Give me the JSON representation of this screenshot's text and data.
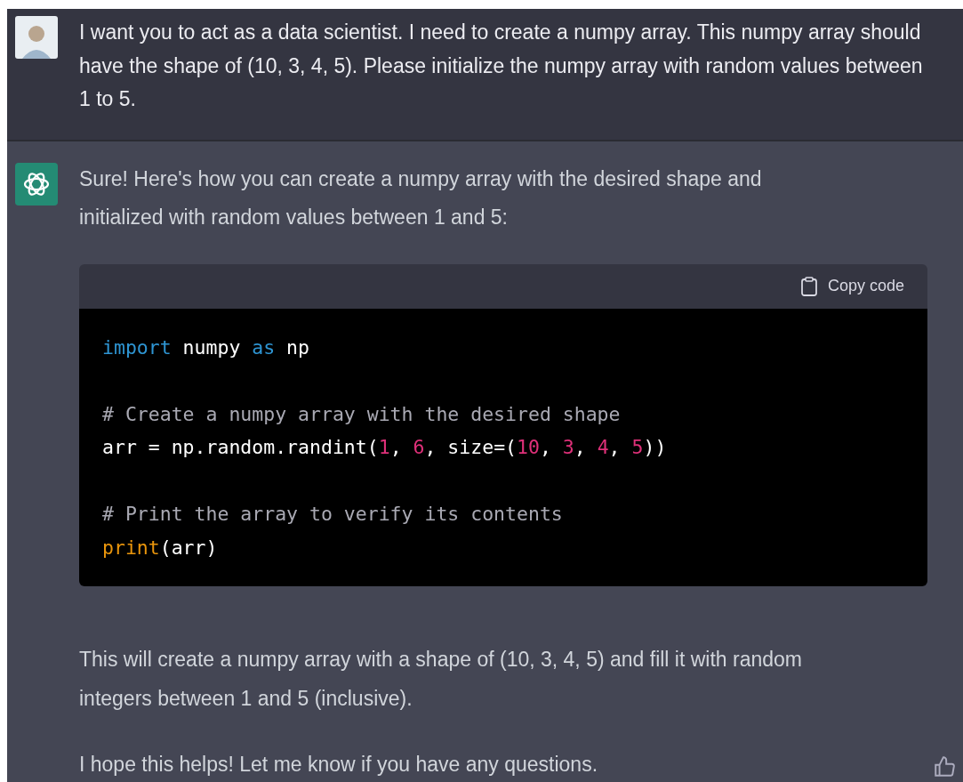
{
  "user_message": {
    "text": "I want you to act as a data scientist. I need to create a numpy array. This numpy array should have the shape of (10, 3, 4, 5). Please initialize the numpy array with random values between 1 to 5."
  },
  "assistant_message": {
    "intro": "Sure! Here's how you can create a numpy array with the desired shape and initialized with random values between 1 and 5:",
    "code_block": {
      "copy_label": "Copy code",
      "groups": [
        [
          [
            {
              "kind": "keyword",
              "text": "import"
            },
            {
              "kind": "plain",
              "text": " numpy "
            },
            {
              "kind": "keyword",
              "text": "as"
            },
            {
              "kind": "plain",
              "text": " np"
            }
          ]
        ],
        [
          [
            {
              "kind": "comment",
              "text": "# Create a numpy array with the desired shape"
            }
          ],
          [
            {
              "kind": "plain",
              "text": "arr = np.random.randint("
            },
            {
              "kind": "number",
              "text": "1"
            },
            {
              "kind": "plain",
              "text": ", "
            },
            {
              "kind": "number",
              "text": "6"
            },
            {
              "kind": "plain",
              "text": ", size=("
            },
            {
              "kind": "number",
              "text": "10"
            },
            {
              "kind": "plain",
              "text": ", "
            },
            {
              "kind": "number",
              "text": "3"
            },
            {
              "kind": "plain",
              "text": ", "
            },
            {
              "kind": "number",
              "text": "4"
            },
            {
              "kind": "plain",
              "text": ", "
            },
            {
              "kind": "number",
              "text": "5"
            },
            {
              "kind": "plain",
              "text": "))"
            }
          ]
        ],
        [
          [
            {
              "kind": "comment",
              "text": "# Print the array to verify its contents"
            }
          ],
          [
            {
              "kind": "builtin",
              "text": "print"
            },
            {
              "kind": "plain",
              "text": "(arr)"
            }
          ]
        ]
      ]
    },
    "paragraphs": [
      "This will create a numpy array with a shape of (10, 3, 4, 5) and fill it with random integers between 1 and 5 (inclusive).",
      "I hope this helps! Let me know if you have any questions."
    ]
  }
}
